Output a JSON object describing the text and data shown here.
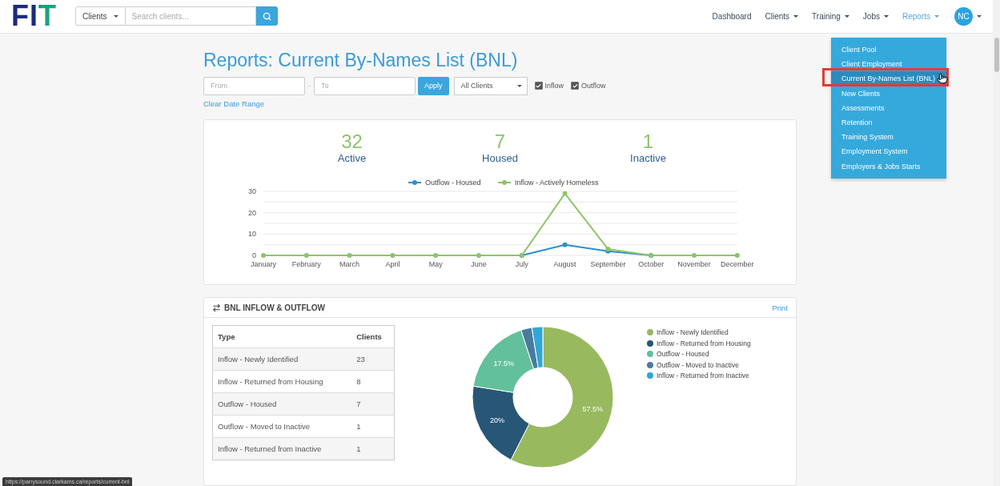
{
  "header": {
    "logo": "FIT",
    "search": {
      "scope": "Clients",
      "placeholder": "Search clients..."
    },
    "nav": [
      {
        "label": "Dashboard",
        "dropdown": false,
        "selected": false
      },
      {
        "label": "Clients",
        "dropdown": true,
        "selected": false
      },
      {
        "label": "Training",
        "dropdown": true,
        "selected": false
      },
      {
        "label": "Jobs",
        "dropdown": true,
        "selected": false
      },
      {
        "label": "Reports",
        "dropdown": true,
        "selected": true
      }
    ],
    "user": {
      "initials": "NC"
    }
  },
  "reports_menu": {
    "items": [
      {
        "label": "Client Pool",
        "highlighted": false
      },
      {
        "label": "Client Employment",
        "highlighted": false
      },
      {
        "label": "Current By-Names List (BNL)",
        "highlighted": true
      },
      {
        "label": "New Clients",
        "highlighted": false
      },
      {
        "label": "Assessments",
        "highlighted": false
      },
      {
        "label": "Retention",
        "highlighted": false
      },
      {
        "label": "Training System",
        "highlighted": false
      },
      {
        "label": "Employment System",
        "highlighted": false
      },
      {
        "label": "Employers & Jobs Starts",
        "highlighted": false
      }
    ]
  },
  "page": {
    "title": "Reports: Current By-Names List (BNL)",
    "filters": {
      "from": {
        "placeholder": "From"
      },
      "separator": "-",
      "to": {
        "placeholder": "To"
      },
      "apply": "Apply",
      "client_select": "All Clients",
      "checkboxes": [
        {
          "label": "Inflow",
          "checked": true
        },
        {
          "label": "Outflow",
          "checked": true
        }
      ],
      "clear_link": "Clear Date Range"
    }
  },
  "summary": {
    "stats": [
      {
        "value": "32",
        "label": "Active"
      },
      {
        "value": "7",
        "label": "Housed"
      },
      {
        "value": "1",
        "label": "Inactive"
      }
    ],
    "chart_data": {
      "type": "line",
      "categories": [
        "January",
        "February",
        "March",
        "April",
        "May",
        "June",
        "July",
        "August",
        "September",
        "October",
        "November",
        "December"
      ],
      "series": [
        {
          "name": "Outflow - Housed",
          "color": "#2b8fcb",
          "marker": "circle",
          "values": [
            null,
            null,
            null,
            null,
            null,
            null,
            0,
            5,
            2,
            0,
            null,
            null
          ]
        },
        {
          "name": "Inflow - Actively Homeless",
          "color": "#8dc46a",
          "marker": "circle",
          "values": [
            0,
            0,
            0,
            0,
            0,
            0,
            0,
            29,
            3,
            0,
            0,
            0
          ]
        }
      ],
      "legend": true,
      "ylim": [
        0,
        30
      ],
      "yticks": [
        0,
        10,
        20,
        30
      ]
    }
  },
  "flow_panel": {
    "title": "BNL INFLOW & OUTFLOW",
    "print": "Print",
    "table": {
      "columns": [
        "Type",
        "Clients"
      ],
      "rows": [
        [
          "Inflow - Newly Identified",
          "23"
        ],
        [
          "Inflow - Returned from Housing",
          "8"
        ],
        [
          "Outflow - Housed",
          "7"
        ],
        [
          "Outflow - Moved to Inactive",
          "1"
        ],
        [
          "Inflow - Returned from Inactive",
          "1"
        ]
      ]
    },
    "chart_data": {
      "type": "donut",
      "categories": [
        "Inflow - Newly Identified",
        "Inflow - Returned from Housing",
        "Outflow - Housed",
        "Outflow - Moved to Inactive",
        "Inflow - Returned from Inactive"
      ],
      "values": [
        57.5,
        20,
        17.5,
        2.5,
        2.5
      ],
      "value_labels": [
        "57.5%",
        "20%",
        "17.5%",
        null,
        null
      ],
      "colors": [
        "#98b95e",
        "#285677",
        "#62c09c",
        "#4a7b9c",
        "#30a7d8"
      ],
      "legend": true
    }
  },
  "status_url": "https://parrysound.clarkams.ca/reports/current-bnl"
}
